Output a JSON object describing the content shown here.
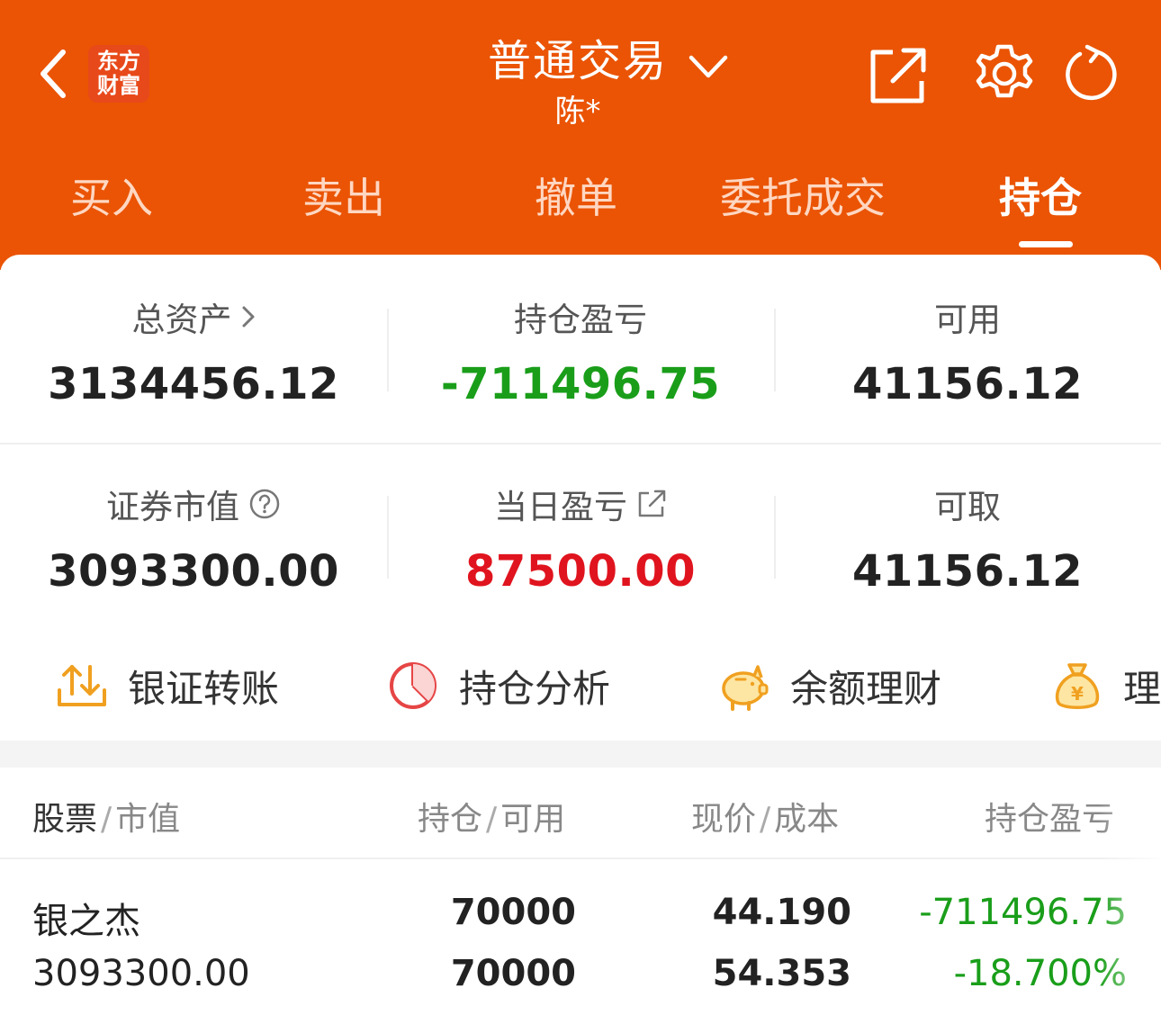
{
  "header": {
    "logo_line1": "东方",
    "logo_line2": "财富",
    "title": "普通交易",
    "subtitle": "陈*",
    "icons": [
      "chevron-left-icon",
      "share-icon",
      "gear-icon",
      "refresh-icon"
    ]
  },
  "tabs": [
    {
      "label": "买入",
      "active": false
    },
    {
      "label": "卖出",
      "active": false
    },
    {
      "label": "撤单",
      "active": false
    },
    {
      "label": "委托成交",
      "active": false
    },
    {
      "label": "持仓",
      "active": true
    }
  ],
  "summary": {
    "total_assets": {
      "label": "总资产",
      "value": "3134456.12"
    },
    "position_pnl": {
      "label": "持仓盈亏",
      "value": "-711496.75"
    },
    "available": {
      "label": "可用",
      "value": "41156.12"
    },
    "market_value": {
      "label": "证券市值",
      "value": "3093300.00"
    },
    "daily_pnl": {
      "label": "当日盈亏",
      "value": "87500.00"
    },
    "withdrawable": {
      "label": "可取",
      "value": "41156.12"
    }
  },
  "shortcuts": [
    {
      "label": "银证转账",
      "icon": "transfer-icon"
    },
    {
      "label": "持仓分析",
      "icon": "pie-chart-icon"
    },
    {
      "label": "余额理财",
      "icon": "piggy-bank-icon"
    },
    {
      "label": "理财",
      "icon": "money-bag-icon"
    }
  ],
  "table": {
    "headers": [
      {
        "main": "股票",
        "sub": "市值"
      },
      {
        "main": "持仓",
        "sub": "可用"
      },
      {
        "main": "现价",
        "sub": "成本"
      },
      {
        "main": "持仓盈亏",
        "sub": ""
      }
    ],
    "rows": [
      {
        "name": "银之杰",
        "market_value": "3093300.00",
        "position": "70000",
        "available": "70000",
        "price": "44.190",
        "cost": "54.353",
        "pnl": "-711496.75",
        "pnl_pct": "-18.700%"
      }
    ]
  },
  "colors": {
    "brand": "#ea5404",
    "loss_green": "#1a9e1a",
    "gain_red": "#e0141e"
  }
}
